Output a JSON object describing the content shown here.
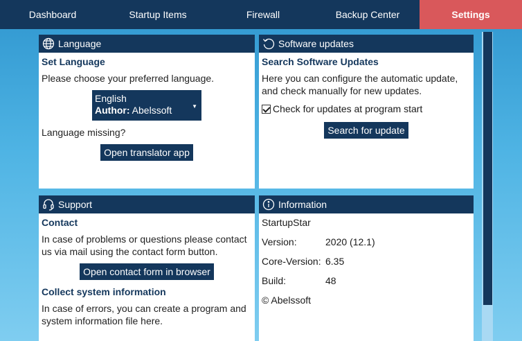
{
  "nav": {
    "tabs": [
      {
        "label": "Dashboard"
      },
      {
        "label": "Startup Items"
      },
      {
        "label": "Firewall"
      },
      {
        "label": "Backup Center"
      },
      {
        "label": "Settings"
      }
    ]
  },
  "language": {
    "title": "Language",
    "heading": "Set Language",
    "description": "Please choose your preferred language.",
    "selected_language": "English",
    "author_label": "Author:",
    "author_name": "Abelssoft",
    "missing_text": "Language missing?",
    "translator_button": "Open translator app"
  },
  "updates": {
    "title": "Software updates",
    "heading": "Search Software Updates",
    "description": "Here you can configure the automatic update, and check manually for new updates.",
    "check_label": "Check for updates at program start",
    "search_button": "Search for update"
  },
  "support": {
    "title": "Support",
    "heading": "Contact",
    "description": "In case of problems or questions please contact us via mail using the contact form button.",
    "contact_button": "Open contact form in browser",
    "sysinfo_heading": "Collect system information",
    "sysinfo_text": "In case of errors, you can create a program and system information file here."
  },
  "information": {
    "title": "Information",
    "product": "StartupStar",
    "version_label": "Version:",
    "version_value": "2020 (12.1)",
    "core_label": "Core-Version:",
    "core_value": "6.35",
    "build_label": "Build:",
    "build_value": "48",
    "copyright": "©  Abelssoft"
  },
  "colors": {
    "nav_bg": "#14375c",
    "active_tab": "#d9585b",
    "accent": "#14375c",
    "background": "#3aa6dc"
  },
  "icons": {
    "language": "globe-icon",
    "updates": "refresh-icon",
    "support": "headset-icon",
    "information": "info-icon"
  }
}
